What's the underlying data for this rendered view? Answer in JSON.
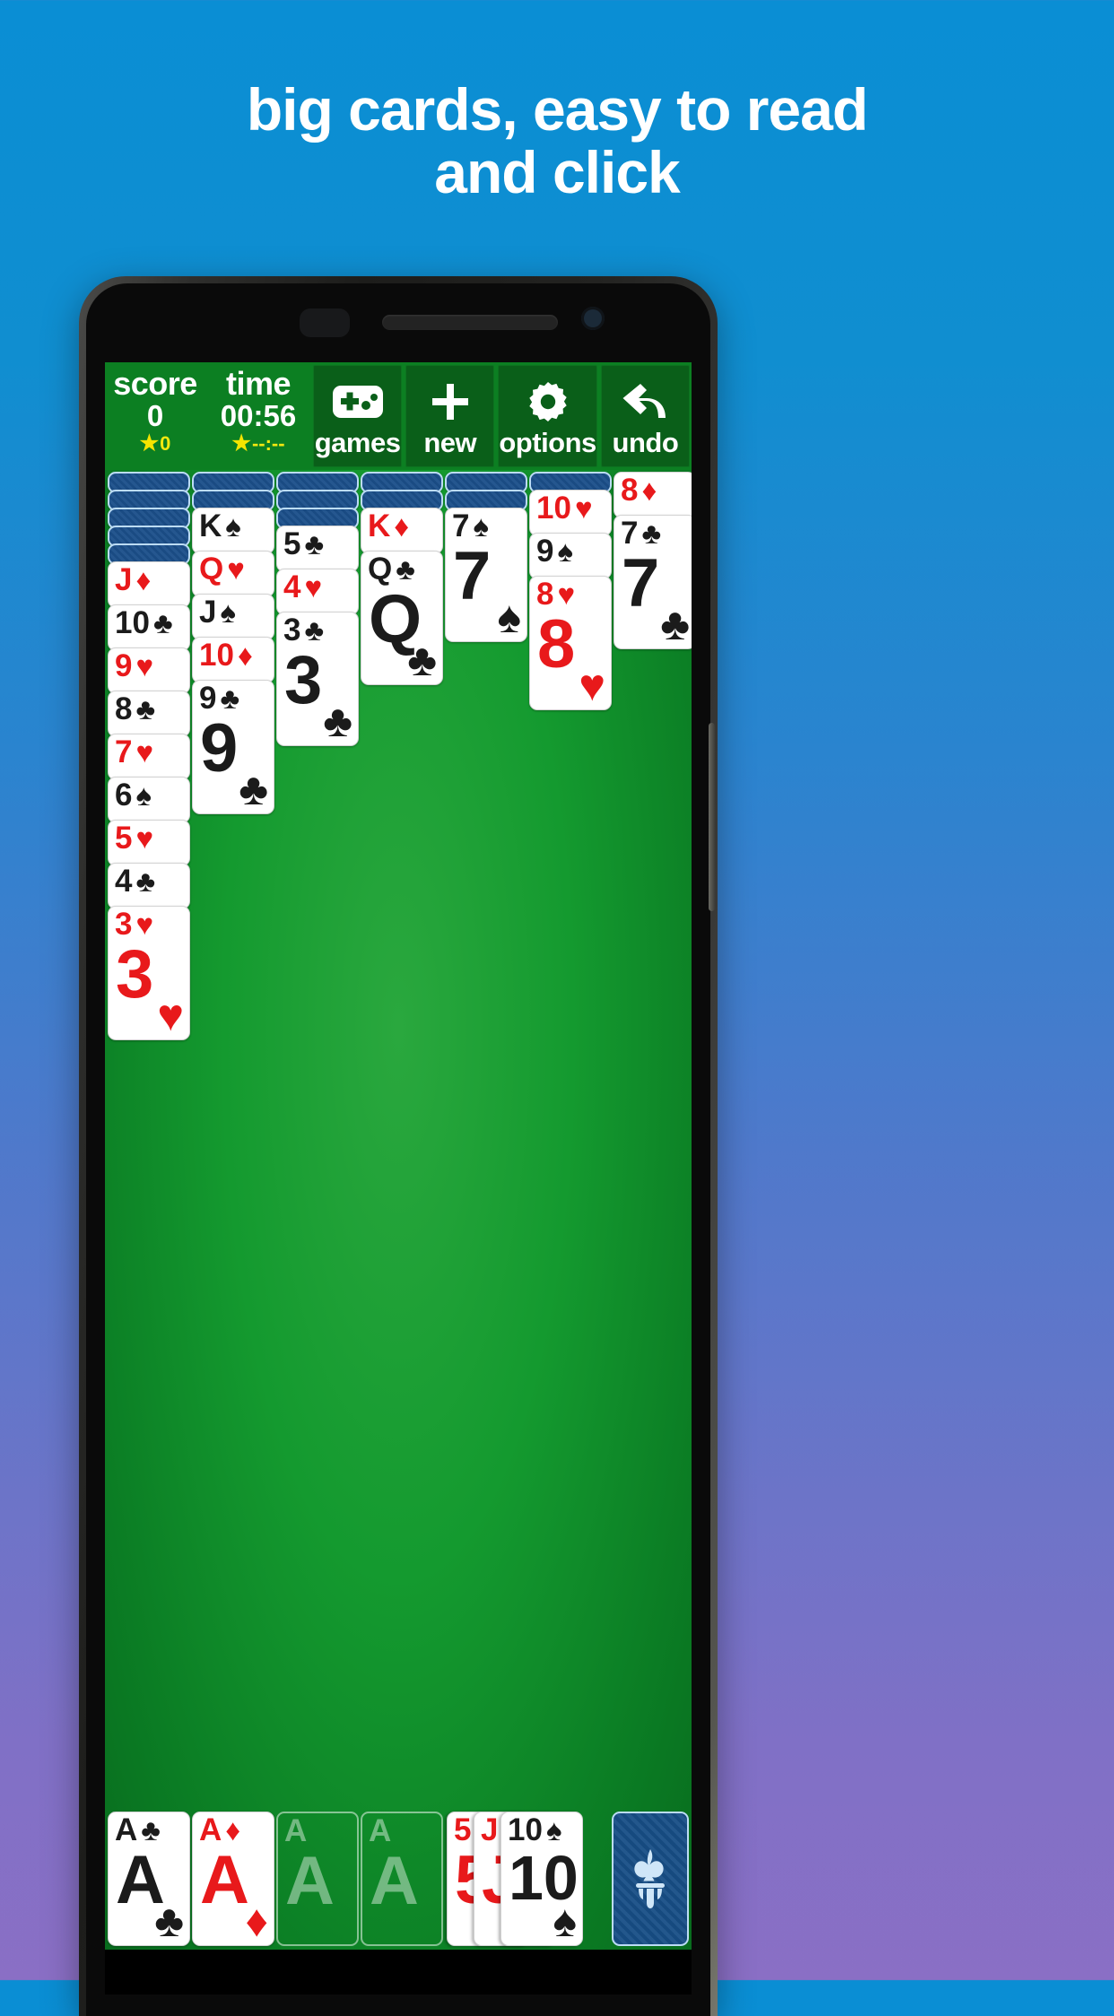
{
  "promo": {
    "headline_line1": "big cards, easy to read",
    "headline_line2": "and click"
  },
  "toolbar": {
    "score": {
      "label": "score",
      "value": "0",
      "best": "0",
      "star_icon": "star-icon"
    },
    "time": {
      "label": "time",
      "value": "00:56",
      "best": "--:--",
      "star_icon": "star-icon"
    },
    "buttons": [
      {
        "label": "games",
        "icon": "gamepad-icon"
      },
      {
        "label": "new",
        "icon": "plus-icon"
      },
      {
        "label": "options",
        "icon": "gear-icon"
      },
      {
        "label": "undo",
        "icon": "undo-arrow-icon"
      }
    ]
  },
  "colors": {
    "felt_green": "#149a2f",
    "toolbar_green": "#0c7f22",
    "card_red": "#e8191b",
    "card_black": "#1b1b1b",
    "card_back_blue": "#1b4f8a",
    "promo_blue": "#0a8ed4"
  },
  "game": {
    "name": "solitaire",
    "tableau": [
      {
        "facedown": 5,
        "cards": [
          {
            "rank": "J",
            "suit": "♦",
            "color": "red"
          },
          {
            "rank": "10",
            "suit": "♣",
            "color": "blk"
          },
          {
            "rank": "9",
            "suit": "♥",
            "color": "red"
          },
          {
            "rank": "8",
            "suit": "♣",
            "color": "blk"
          },
          {
            "rank": "7",
            "suit": "♥",
            "color": "red"
          },
          {
            "rank": "6",
            "suit": "♠",
            "color": "blk"
          },
          {
            "rank": "5",
            "suit": "♥",
            "color": "red"
          },
          {
            "rank": "4",
            "suit": "♣",
            "color": "blk"
          },
          {
            "rank": "3",
            "suit": "♥",
            "color": "red"
          }
        ]
      },
      {
        "facedown": 2,
        "cards": [
          {
            "rank": "K",
            "suit": "♠",
            "color": "blk"
          },
          {
            "rank": "Q",
            "suit": "♥",
            "color": "red"
          },
          {
            "rank": "J",
            "suit": "♠",
            "color": "blk"
          },
          {
            "rank": "10",
            "suit": "♦",
            "color": "red"
          },
          {
            "rank": "9",
            "suit": "♣",
            "color": "blk"
          }
        ]
      },
      {
        "facedown": 3,
        "cards": [
          {
            "rank": "5",
            "suit": "♣",
            "color": "blk"
          },
          {
            "rank": "4",
            "suit": "♥",
            "color": "red"
          },
          {
            "rank": "3",
            "suit": "♣",
            "color": "blk"
          }
        ]
      },
      {
        "facedown": 2,
        "cards": [
          {
            "rank": "K",
            "suit": "♦",
            "color": "red"
          },
          {
            "rank": "Q",
            "suit": "♣",
            "color": "blk"
          }
        ]
      },
      {
        "facedown": 2,
        "cards": [
          {
            "rank": "7",
            "suit": "♠",
            "color": "blk"
          }
        ]
      },
      {
        "facedown": 1,
        "cards": [
          {
            "rank": "10",
            "suit": "♥",
            "color": "red"
          },
          {
            "rank": "9",
            "suit": "♠",
            "color": "blk"
          },
          {
            "rank": "8",
            "suit": "♥",
            "color": "red"
          }
        ]
      },
      {
        "facedown": 0,
        "cards": [
          {
            "rank": "8",
            "suit": "♦",
            "color": "red"
          },
          {
            "rank": "7",
            "suit": "♣",
            "color": "blk"
          }
        ]
      }
    ],
    "foundations": [
      {
        "rank": "A",
        "suit": "♣",
        "color": "blk",
        "empty": false
      },
      {
        "rank": "A",
        "suit": "♦",
        "color": "red",
        "empty": false
      },
      {
        "rank": "A",
        "suit": "",
        "color": "blk",
        "empty": true
      },
      {
        "rank": "A",
        "suit": "",
        "color": "blk",
        "empty": true
      }
    ],
    "waste": [
      {
        "rank": "5",
        "suit": "♥",
        "color": "red"
      },
      {
        "rank": "J",
        "suit": "♦",
        "color": "red"
      },
      {
        "rank": "10",
        "suit": "♠",
        "color": "blk"
      }
    ],
    "stock": {
      "icon": "fleur-de-lis-icon",
      "face_down": true
    }
  }
}
